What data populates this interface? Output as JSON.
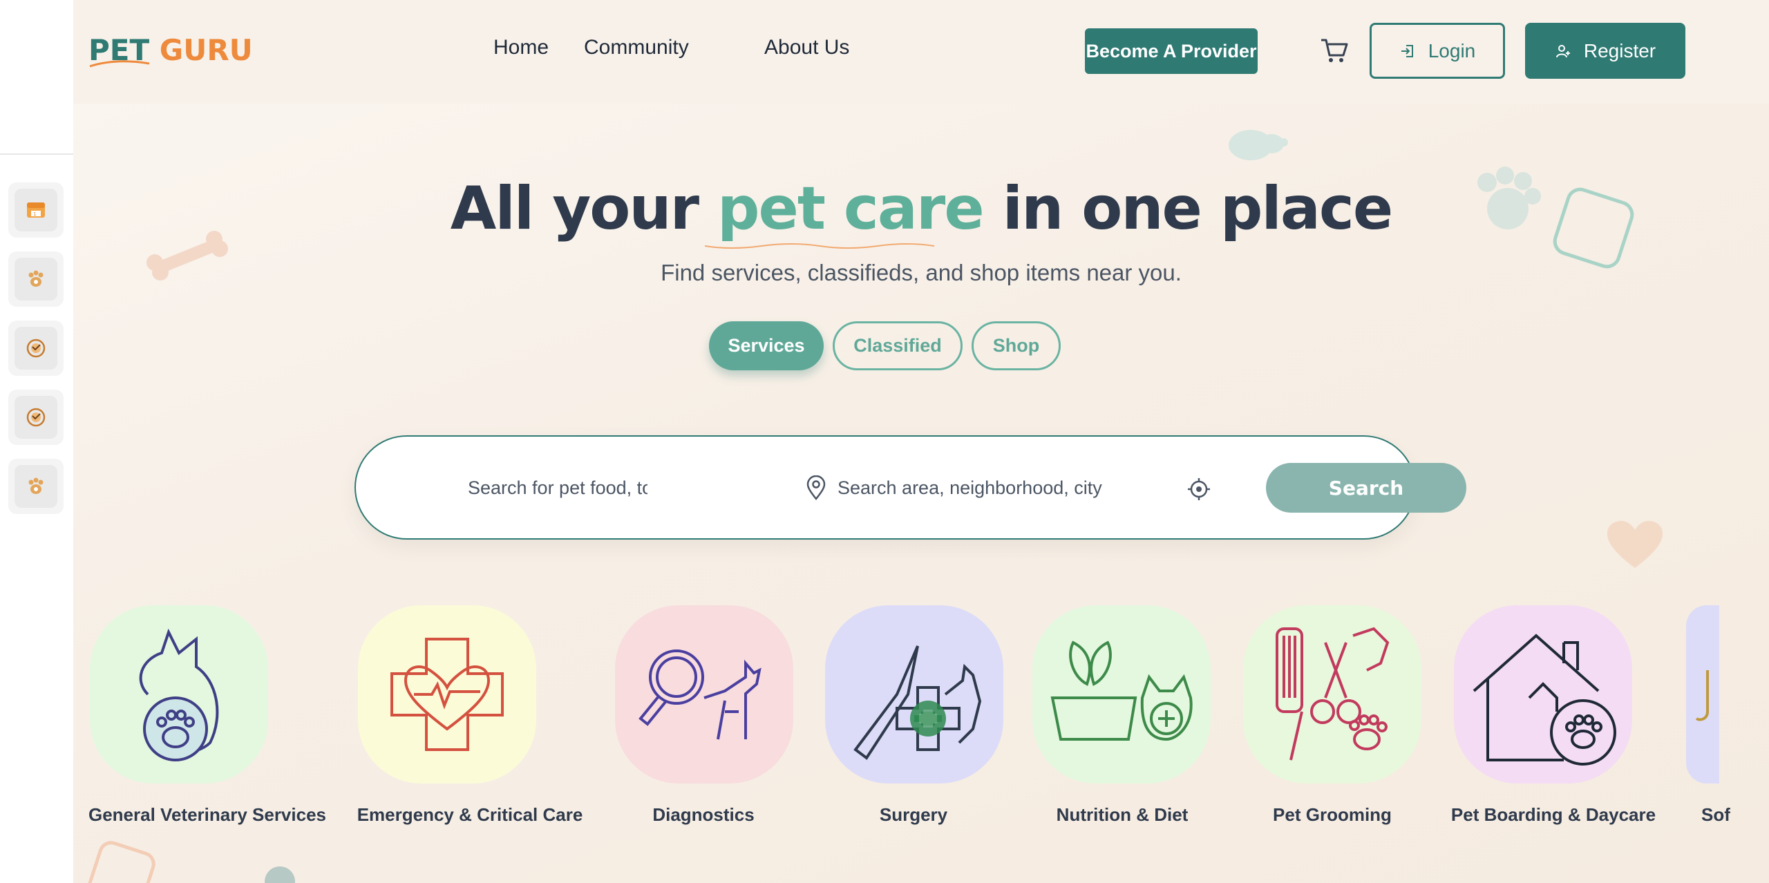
{
  "brand": {
    "part1": "PET",
    "part2": "GURU",
    "colors": {
      "primary": "#2f7a73",
      "accent": "#ee8a3c",
      "mint": "#5fb09a"
    }
  },
  "nav": {
    "home": "Home",
    "community": "Community",
    "about": "About Us"
  },
  "header_actions": {
    "provider": "Become A Provider",
    "cart_icon": "cart-icon",
    "login": "Login",
    "register": "Register"
  },
  "rail": {
    "items": [
      "store-icon",
      "paw-icon",
      "pet-badge-icon",
      "pet-badge-icon",
      "paw-icon"
    ]
  },
  "hero": {
    "title_pre": "All your",
    "title_accent": "pet care",
    "title_post": "in one place",
    "subtitle": "Find services, classifieds, and shop items near you."
  },
  "tabs": {
    "services": "Services",
    "classified": "Classified",
    "shop": "Shop",
    "active": "Services"
  },
  "search": {
    "query_placeholder": "Search for pet food, toys",
    "location_placeholder": "Search area, neighborhood, city",
    "button": "Search"
  },
  "categories": [
    {
      "label": "General Veterinary Services",
      "icon": "vet-dog-paw-icon",
      "bg": "#e4f8df"
    },
    {
      "label": "Emergency & Critical Care",
      "icon": "heart-cross-dog-icon",
      "bg": "#fbfbd8"
    },
    {
      "label": "Diagnostics",
      "icon": "magnifier-dog-icon",
      "bg": "#f8dcde"
    },
    {
      "label": "Surgery",
      "icon": "scalpel-cross-dog-icon",
      "bg": "#dcdcf8"
    },
    {
      "label": "Nutrition & Diet",
      "icon": "food-bowl-cat-icon",
      "bg": "#e4f8df"
    },
    {
      "label": "Pet Grooming",
      "icon": "comb-scissors-dog-icon",
      "bg": "#e8f8dc"
    },
    {
      "label": "Pet Boarding & Daycare",
      "icon": "house-dog-paw-icon",
      "bg": "#f4dcf4"
    },
    {
      "label": "Sof",
      "icon": "partial-category-icon",
      "bg": "#dcdcf8"
    }
  ]
}
